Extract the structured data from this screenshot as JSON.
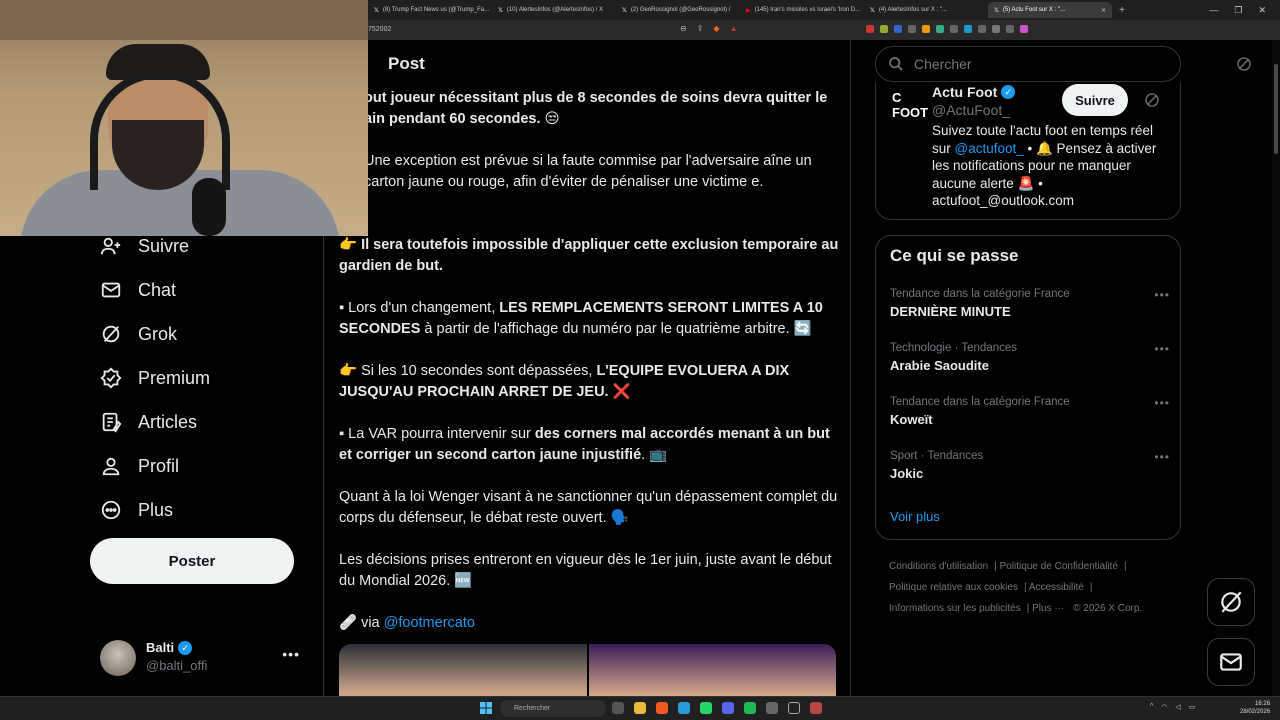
{
  "browser": {
    "tabs": [
      {
        "label": "(8) Trump Fact News us (@Trump_Fa..."
      },
      {
        "label": "(10) AlertesInfos (@AlertesInfos) / X"
      },
      {
        "label": "(2) GeoRossignol (@GeoRossignol) /"
      },
      {
        "label": "(145) Iran's missiles vs Israel's 'Iron D..."
      },
      {
        "label": "(4) AlertesInfos sur X : \"..."
      },
      {
        "label": "(5) Actu Foot sur X : \"..."
      }
    ],
    "new_tab": "+",
    "url": "752002"
  },
  "nav": {
    "items": [
      {
        "label": "Suivre",
        "icon": "follow-icon"
      },
      {
        "label": "Chat",
        "icon": "mail-icon"
      },
      {
        "label": "Grok",
        "icon": "grok-icon"
      },
      {
        "label": "Premium",
        "icon": "premium-icon"
      },
      {
        "label": "Articles",
        "icon": "articles-icon"
      },
      {
        "label": "Profil",
        "icon": "profile-icon"
      },
      {
        "label": "Plus",
        "icon": "more-icon"
      }
    ],
    "post_button": "Poster",
    "account": {
      "name": "Balti",
      "handle": "@balti_offi",
      "more": "•••"
    }
  },
  "main": {
    "header": "Post",
    "paragraphs": [
      {
        "bold": "out joueur nécessitant plus de 8 secondes de soins devra quitter le ain pendant 60 secondes. 😒",
        "normal": ""
      },
      {
        "bold": "",
        "normal": "Une exception est prévue si la faute commise par l'adversaire aîne un carton jaune ou rouge, afin d'éviter de pénaliser une victime e."
      },
      {
        "bold": "👉 Il sera toutefois impossible d'appliquer cette exclusion temporaire au gardien de but.",
        "normal": ""
      },
      {
        "prefix": "▪ Lors d'un changement, ",
        "bold": "LES REMPLACEMENTS SERONT LIMITES A 10 SECONDES",
        "suffix": " à partir de l'affichage du numéro par le quatrième arbitre. 🔄"
      },
      {
        "prefix": "👉 Si les 10 secondes sont dépassées, ",
        "bold": "L'EQUIPE EVOLUERA A DIX JUSQU'AU PROCHAIN ARRET DE JEU.",
        "suffix": " ❌"
      },
      {
        "prefix": "▪ La VAR pourra intervenir sur ",
        "bold": "des corners mal accordés menant à un but et corriger un second carton jaune injustifié",
        "suffix": ". 📺"
      },
      {
        "bold": "",
        "normal": "Quant à la loi Wenger visant à ne sanctionner qu'un dépassement complet du corps du défenseur, le débat reste ouvert. 🗣️"
      },
      {
        "bold": "",
        "normal": "Les décisions prises entreront en vigueur dès le 1er juin, juste avant le début du Mondial 2026. 🆕"
      },
      {
        "prefix": "🩹 via ",
        "link": "@footmercato"
      }
    ]
  },
  "right": {
    "search_placeholder": "Chercher",
    "profile": {
      "logo": "C FOOT",
      "name": "Actu Foot",
      "handle": "@ActuFoot_",
      "follow": "Suivre",
      "bio_1": "Suivez toute l'actu foot en temps réel sur ",
      "bio_link": "@actufoot_",
      "bio_2": " • 🔔 Pensez à activer les notifications pour ne manquer aucune alerte 🚨 • actufoot_@outlook.com"
    },
    "trends_title": "Ce qui se passe",
    "trends": [
      {
        "category": "Tendance dans la catégorie France",
        "name": "DERNIÈRE MINUTE"
      },
      {
        "category": "Technologie · Tendances",
        "name": "Arabie Saoudite"
      },
      {
        "category": "Tendance dans la catégorie France",
        "name": "Koweït"
      },
      {
        "category": "Sport · Tendances",
        "name": "Jokic"
      }
    ],
    "trend_more": "•••",
    "see_more": "Voir plus",
    "footer": {
      "terms": "Conditions d'utilisation",
      "privacy": "Politique de Confidentialité",
      "cookies": "Politique relative aux cookies",
      "access": "Accessibilité",
      "ads": "Informations sur les publicités",
      "more": "Plus ···",
      "copyright": "© 2026 X Corp."
    }
  },
  "taskbar": {
    "search": "Rechercher",
    "time": "16:26",
    "date": "28/02/2026"
  },
  "colors": {
    "accent": "#1d9bf0",
    "background": "#000000",
    "border": "#2f3336"
  }
}
